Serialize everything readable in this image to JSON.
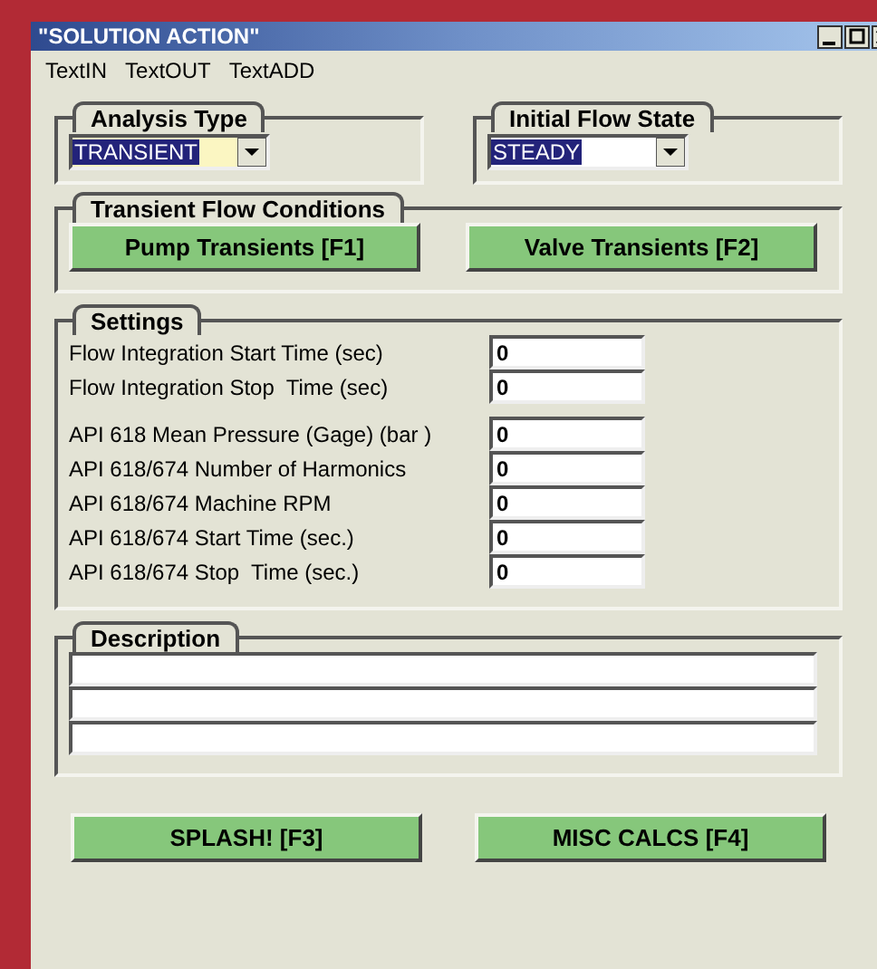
{
  "window": {
    "title": "\"SOLUTION ACTION\""
  },
  "menu": [
    "TextIN",
    "TextOUT",
    "TextADD"
  ],
  "combos": [
    {
      "title": "Analysis Type",
      "value": "TRANSIENT",
      "focused": true
    },
    {
      "title": "Initial Flow State",
      "value": "STEADY",
      "focused": false
    }
  ],
  "transient": {
    "title": "Transient Flow Conditions",
    "buttons": [
      "Pump Transients [F1]",
      "Valve Transients [F2]"
    ]
  },
  "settings": {
    "title": "Settings",
    "sections": [
      {
        "rows": [
          {
            "label": "Flow Integration Start Time (sec)",
            "value": "0"
          },
          {
            "label": "Flow Integration Stop  Time (sec)",
            "value": "0"
          }
        ]
      },
      {
        "rows": [
          {
            "label": "API 618 Mean Pressure (Gage) (bar )",
            "value": "0"
          },
          {
            "label": "API 618/674 Number of Harmonics",
            "value": "0"
          },
          {
            "label": "API 618/674 Machine RPM",
            "value": "0"
          },
          {
            "label": "API 618/674 Start Time (sec.)",
            "value": "0"
          },
          {
            "label": "API 618/674 Stop  Time (sec.)",
            "value": "0"
          }
        ]
      }
    ]
  },
  "description": {
    "title": "Description",
    "lines": [
      {
        "kind": "text-line"
      },
      {
        "kind": "text-line"
      },
      {
        "kind": "text-line"
      }
    ]
  },
  "buttons": [
    "SPLASH! [F3]",
    "MISC CALCS [F4]"
  ]
}
